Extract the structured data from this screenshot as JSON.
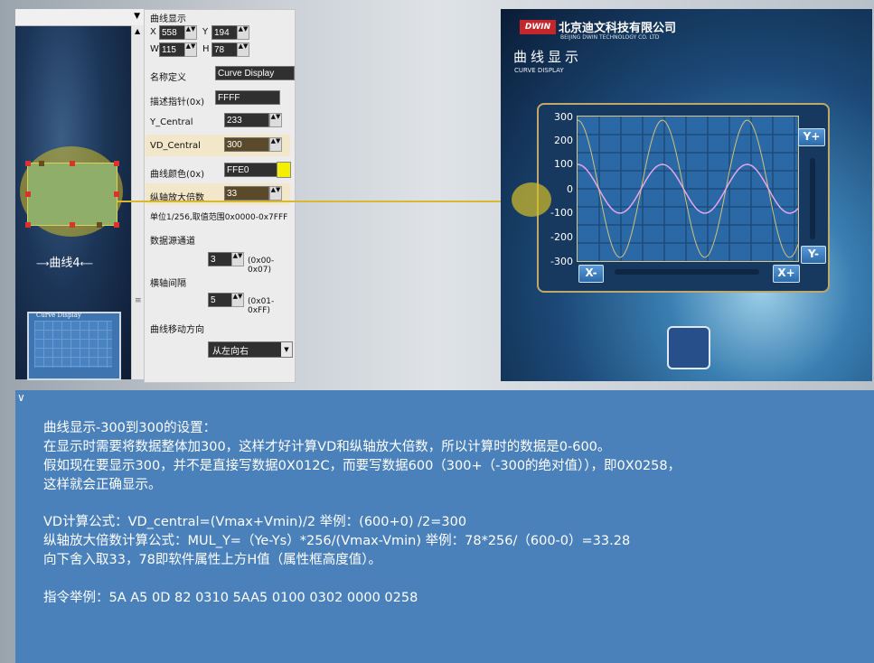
{
  "editor": {
    "canvas_label": "曲线4",
    "mini_panel_title": "Curve Display"
  },
  "props": {
    "header": "曲线显示",
    "x_label": "X",
    "x_value": "558",
    "y_label": "Y",
    "y_value": "194",
    "w_label": "W",
    "w_value": "115",
    "h_label": "H",
    "h_value": "78",
    "name_label": "名称定义",
    "name_value": "Curve Display",
    "desc_label": "描述指针(0x)",
    "desc_value": "FFFF",
    "ycentral_label": "Y_Central",
    "ycentral_value": "233",
    "vdcentral_label": "VD_Central",
    "vdcentral_value": "300",
    "color_label": "曲线颜色(0x)",
    "color_value": "FFE0",
    "color_swatch": "#f4ee00",
    "mul_label": "纵轴放大倍数",
    "mul_value": "33",
    "unit_note": "单位1/256,取值范围0x0000-0x7FFF",
    "channel_label": "数据源通道",
    "channel_value": "3",
    "channel_range": "(0x00-0x07)",
    "xgap_label": "横轴间隔",
    "xgap_value": "5",
    "xgap_range": "(0x01-0xFF)",
    "dir_label": "曲线移动方向",
    "dir_value": "从左向右"
  },
  "preview": {
    "logo": "DWIN",
    "company": "北京迪文科技有限公司",
    "company_en": "BEIJING DWIN TECHNOLOGY CO. LTD",
    "title": "曲线显示",
    "subtitle": "CURVE DISPLAY",
    "y_ticks": [
      "300",
      "200",
      "100",
      "0",
      "-100",
      "-200",
      "-300"
    ],
    "btn_yplus": "Y+",
    "btn_yminus": "Y-",
    "btn_xminus": "X-",
    "btn_xplus": "X+"
  },
  "notes": {
    "marker": "∨",
    "l1": "曲线显示-300到300的设置：",
    "l2": "在显示时需要将数据整体加300，这样才好计算VD和纵轴放大倍数，所以计算时的数据是0-600。",
    "l3": "假如现在要显示300，并不是直接写数据0X012C，而要写数据600（300+（-300的绝对值）），即0X0258，",
    "l4": "这样就会正确显示。",
    "l5": "VD计算公式：VD_central=(Vmax+Vmin)/2  举例：(600+0) /2=300",
    "l6": "纵轴放大倍数计算公式：MUL_Y=（Ye-Ys）*256/(Vmax-Vmin) 举例：78*256/（600-0）=33.28",
    "l7": "向下舍入取33，78即软件属性上方H值（属性框高度值）。",
    "l8": "指令举例：5A A5 0D 82 0310 5AA5 0100 0302 0000 0258"
  },
  "colors": {
    "accent_yellow": "#d8b830",
    "panel_blue": "#4a81bb",
    "curve_pink": "#e6a6e8",
    "curve_gold": "#d4c278"
  }
}
